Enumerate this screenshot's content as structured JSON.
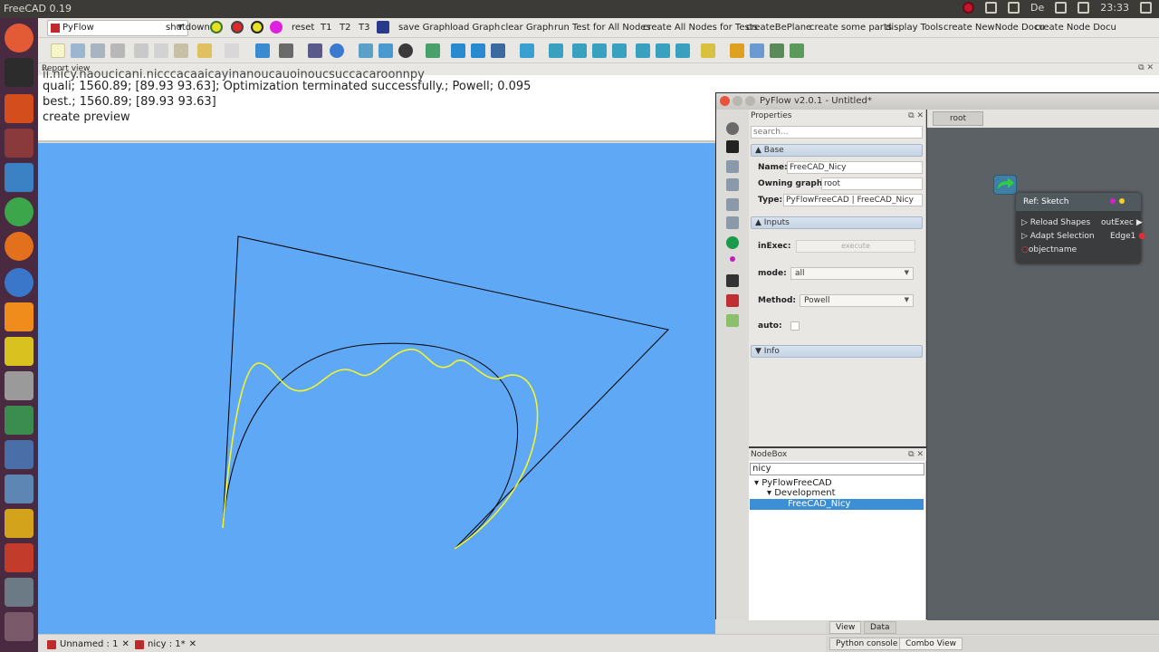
{
  "topbar": {
    "title": "FreeCAD 0.19",
    "time": "23:33",
    "lang": "De"
  },
  "toolbar": {
    "workbench": "PyFlow",
    "items": [
      "shutdown",
      "reset",
      "T1",
      "T2",
      "T3",
      "save Graph",
      "load Graph",
      "clear Graph",
      "run Test for All Nodes",
      "create All Nodes for Tests",
      "createBePlane",
      "create some parts",
      "display Tools",
      "create NewNode Docu",
      "create Node Docu"
    ]
  },
  "report": {
    "title": "Report view",
    "line0": "ii.nicy.naoucicani.nicccacaaicayinanoucauoinoucsuccacaroonnpy",
    "line1": "quali; 1560.89; [89.93 93.63]; Optimization terminated successfully.; Powell; 0.095",
    "line2": "best.; 1560.89; [89.93 93.63]",
    "line3": "create preview"
  },
  "doc_tabs": [
    {
      "label": "Unnamed : 1"
    },
    {
      "label": "nicy : 1*"
    }
  ],
  "right_tabs": {
    "view": "View",
    "data": "Data",
    "python": "Python console",
    "combo": "Combo View"
  },
  "pyflow": {
    "title": "PyFlow v2.0.1 - Untitled*",
    "properties": {
      "header": "Properties",
      "search_placeholder": "search...",
      "base_label": "Base",
      "name_label": "Name:",
      "name_value": "FreeCAD_Nicy",
      "graph_label": "Owning graph:",
      "graph_value": "root",
      "type_label": "Type:",
      "type_value": "PyFlowFreeCAD | FreeCAD_Nicy",
      "inputs_label": "Inputs",
      "inexec_label": "inExec:",
      "inexec_button": "execute",
      "mode_label": "mode:",
      "mode_value": "all",
      "method_label": "Method:",
      "method_value": "Powell",
      "auto_label": "auto:",
      "info_label": "Info"
    },
    "nodebox": {
      "header": "NodeBox",
      "search_value": "nicy",
      "tree": [
        "PyFlowFreeCAD",
        "Development",
        "FreeCAD_Nicy"
      ]
    },
    "canvas": {
      "tab": "root",
      "node": {
        "title": "Ref: Sketch",
        "inputs": [
          "Reload Shapes",
          "Adapt Selection",
          "objectname"
        ],
        "outputs": [
          "outExec",
          "Edge1"
        ]
      }
    }
  }
}
